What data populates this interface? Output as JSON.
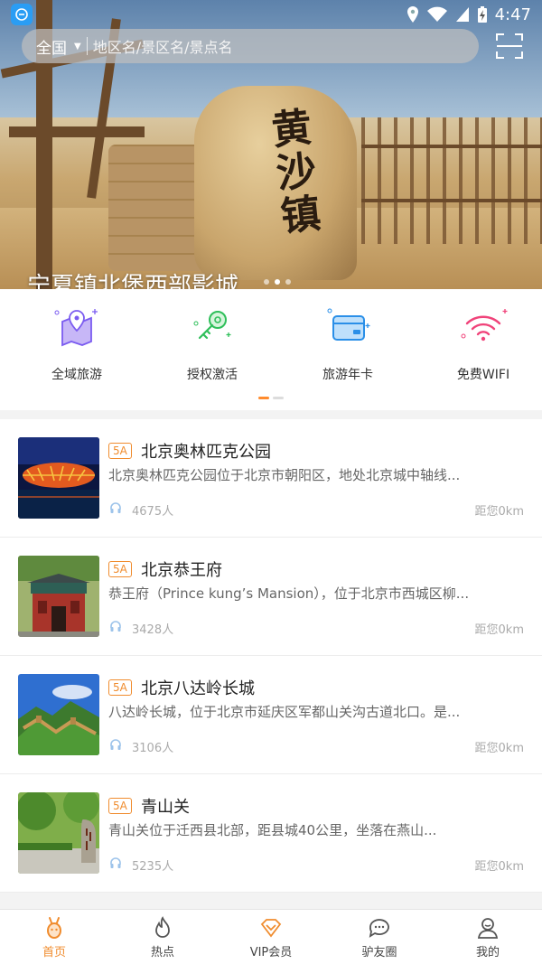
{
  "statusbar": {
    "time": "4:47"
  },
  "search": {
    "region": "全国",
    "placeholder": "地区名/景区名/景点名"
  },
  "banner": {
    "stone_text": "黄沙镇",
    "caption": "宁夏镇北堡西部影城"
  },
  "quick_menu": [
    {
      "label": "全域旅游",
      "icon": "map-pin-icon"
    },
    {
      "label": "授权激活",
      "icon": "key-icon"
    },
    {
      "label": "旅游年卡",
      "icon": "card-icon"
    },
    {
      "label": "免费WIFI",
      "icon": "wifi-icon"
    }
  ],
  "list": [
    {
      "badge": "5A",
      "title": "北京奥林匹克公园",
      "desc": "北京奥林匹克公园位于北京市朝阳区，地处北京城中轴线...",
      "count": "4675人",
      "distance": "距您0km"
    },
    {
      "badge": "5A",
      "title": "北京恭王府",
      "desc": "恭王府（Prince kung’s Mansion），位于北京市西城区柳...",
      "count": "3428人",
      "distance": "距您0km"
    },
    {
      "badge": "5A",
      "title": "北京八达岭长城",
      "desc": "八达岭长城，位于北京市延庆区军都山关沟古道北口。是...",
      "count": "3106人",
      "distance": "距您0km"
    },
    {
      "badge": "5A",
      "title": "青山关",
      "desc": "青山关位于迁西县北部，距县城40公里，坐落在燕山...",
      "count": "5235人",
      "distance": "距您0km"
    }
  ],
  "tabbar": [
    {
      "label": "首页",
      "active": true
    },
    {
      "label": "热点"
    },
    {
      "label": "VIP会员"
    },
    {
      "label": "驴友圈"
    },
    {
      "label": "我的"
    }
  ],
  "colors": {
    "accent": "#f08c2e",
    "badge": "#f08c2e"
  }
}
